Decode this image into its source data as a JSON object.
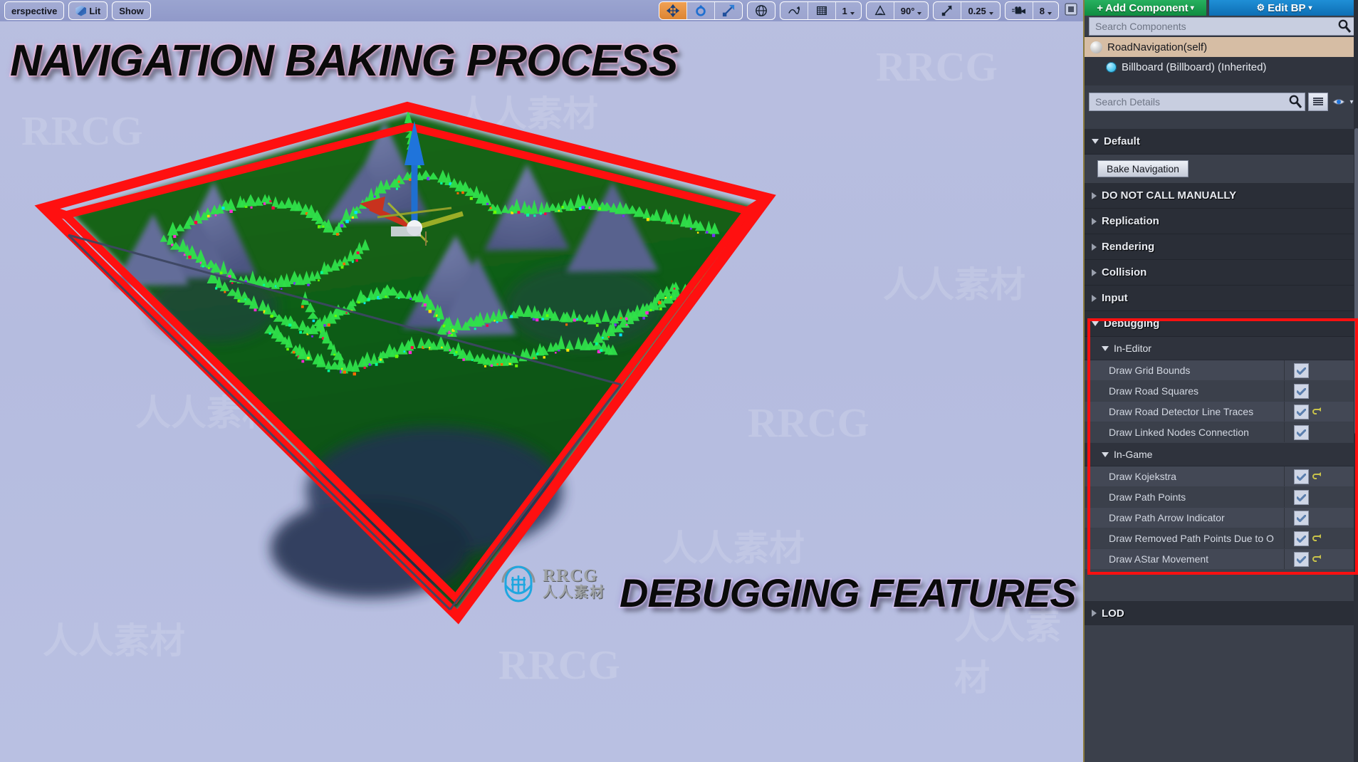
{
  "viewport": {
    "toolbar": {
      "view_mode_label": "erspective",
      "lighting_label": "Lit",
      "show_label": "Show",
      "transform_tools": [
        {
          "name": "translate-tool",
          "icon": "move-icon",
          "active": true
        },
        {
          "name": "rotate-tool",
          "icon": "rotate-icon",
          "active": false
        },
        {
          "name": "scale-tool",
          "icon": "scale-icon",
          "active": false
        }
      ],
      "coordinate_system_icon": "globe-icon",
      "surface_snap_icon": "surface-snap-icon",
      "grid_snap_icon": "grid-icon",
      "grid_snap_value": "1",
      "angle_snap_icon": "angle-icon",
      "angle_snap_value": "90°",
      "scale_snap_icon": "scale-snap-icon",
      "scale_snap_value": "0.25",
      "camera_speed_icon": "camera-icon",
      "camera_speed_value": "8",
      "maximize_icon": "maximize-icon"
    },
    "overlay_title_top": "NAVIGATION BAKING PROCESS",
    "overlay_title_bottom": "DEBUGGING FEATURES",
    "watermark": {
      "brand_en": "RRCG",
      "brand_cn": "人人素材",
      "tiles": [
        "RRCG",
        "人人素材",
        "RRCG",
        "人人素材",
        "RRCG",
        "人人素材",
        "RRCG",
        "人人素材",
        "RRCG"
      ]
    },
    "scene": {
      "bounds_color": "#ff1010",
      "ground_color": "#0f5a14",
      "mountain_color": "#5c6590",
      "tree_color": "#2fe04a",
      "sky_color": "#b7bee0",
      "gizmo": {
        "x_axis_color": "#c8321e",
        "y_axis_color": "#9aad27",
        "z_axis_color": "#1f6fd0"
      }
    }
  },
  "panel": {
    "add_component_label": "Add Component",
    "edit_blueprint_label": "Edit BP",
    "search_components_placeholder": "Search Components",
    "components": [
      {
        "label": "RoadNavigation(self)",
        "icon": "sphere-icon",
        "selected": true,
        "indent": 0
      },
      {
        "label": "Billboard (Billboard) (Inherited)",
        "icon": "billboard-icon",
        "selected": false,
        "indent": 1
      }
    ],
    "search_details_placeholder": "Search Details",
    "details_view_icon": "grid-view-icon",
    "details_eye_icon": "eye-icon",
    "categories": [
      {
        "label": "Default",
        "expanded": true
      },
      {
        "label": "DO NOT CALL MANUALLY",
        "expanded": false
      },
      {
        "label": "Replication",
        "expanded": false
      },
      {
        "label": "Rendering",
        "expanded": false
      },
      {
        "label": "Collision",
        "expanded": false
      },
      {
        "label": "Input",
        "expanded": false
      }
    ],
    "bake_button_label": "Bake Navigation",
    "debugging": {
      "label": "Debugging",
      "expanded": true,
      "groups": [
        {
          "label": "In-Editor",
          "expanded": true,
          "properties": [
            {
              "label": "Draw Grid Bounds",
              "checked": true,
              "has_reset": false
            },
            {
              "label": "Draw Road Squares",
              "checked": true,
              "has_reset": false
            },
            {
              "label": "Draw Road Detector Line Traces",
              "checked": true,
              "has_reset": true
            },
            {
              "label": "Draw Linked Nodes Connection",
              "checked": true,
              "has_reset": false
            }
          ]
        },
        {
          "label": "In-Game",
          "expanded": true,
          "properties": [
            {
              "label": "Draw Kojekstra",
              "checked": true,
              "has_reset": true
            },
            {
              "label": "Draw Path Points",
              "checked": true,
              "has_reset": false
            },
            {
              "label": "Draw Path Arrow Indicator",
              "checked": true,
              "has_reset": false
            },
            {
              "label": "Draw Removed Path Points Due to O",
              "checked": true,
              "has_reset": true
            },
            {
              "label": "Draw AStar Movement",
              "checked": true,
              "has_reset": true
            }
          ]
        }
      ]
    },
    "lod_label": "LOD",
    "annotation_color": "#ff1010"
  }
}
